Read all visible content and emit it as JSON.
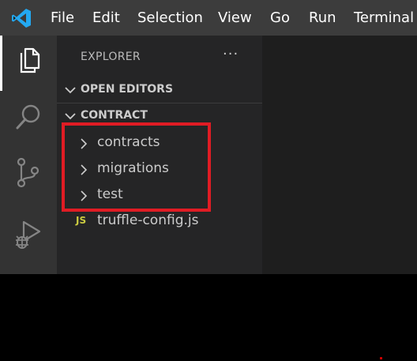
{
  "menu": {
    "items": [
      "File",
      "Edit",
      "Selection",
      "View",
      "Go",
      "Run",
      "Terminal"
    ]
  },
  "activity_bar": {
    "items": [
      "files-icon",
      "search-icon",
      "source-control-icon",
      "run-debug-icon"
    ],
    "active": "files-icon"
  },
  "explorer": {
    "title": "EXPLORER",
    "more_label": "···",
    "sections": [
      {
        "label": "OPEN EDITORS",
        "expanded": true
      },
      {
        "label": "CONTRACT",
        "expanded": true
      }
    ],
    "tree": [
      {
        "label": "contracts",
        "type": "folder"
      },
      {
        "label": "migrations",
        "type": "folder"
      },
      {
        "label": "test",
        "type": "folder"
      },
      {
        "label": "truffle-config.js",
        "type": "file",
        "badge": "JS"
      }
    ]
  },
  "colors": {
    "accent": "#23a9f2",
    "highlight": "#e01c24",
    "js_badge": "#cbcb41"
  }
}
